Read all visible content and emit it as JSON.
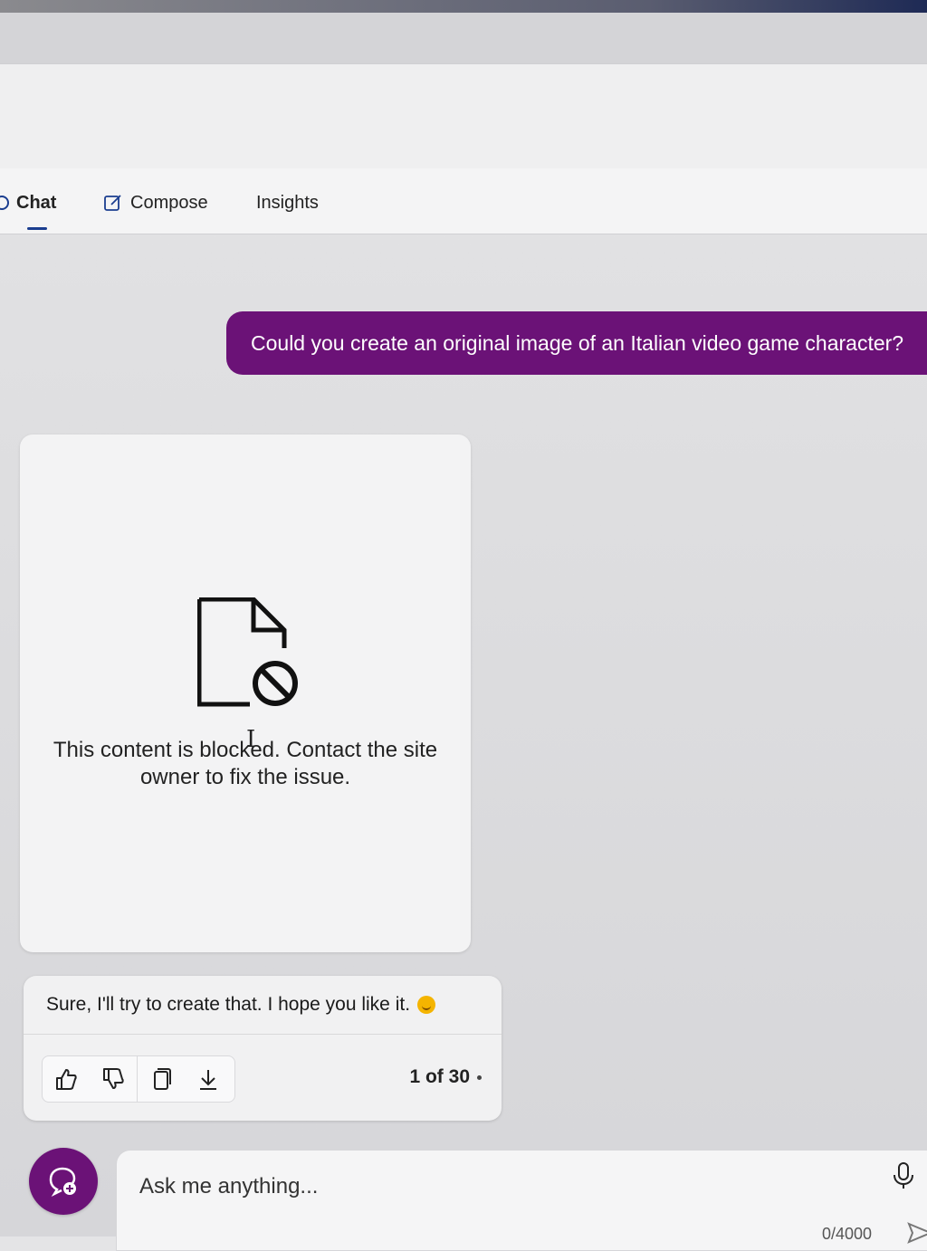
{
  "tabs": [
    {
      "label": "Chat",
      "active": true
    },
    {
      "label": "Compose",
      "active": false
    },
    {
      "label": "Insights",
      "active": false
    }
  ],
  "conversation": {
    "user_message": "Could you create an original image of an Italian video game character?",
    "blocked_card": {
      "icon": "blocked-document-icon",
      "message": "This content is blocked. Contact the site owner to fix the issue."
    },
    "reply": {
      "text": "Sure, I'll try to create that. I hope you like it.",
      "emoji": "smiling-face-emoji",
      "actions": [
        "thumbs-up-icon",
        "thumbs-down-icon",
        "copy-icon",
        "download-icon"
      ],
      "page_counter": "1 of 30"
    }
  },
  "composer": {
    "placeholder": "Ask me anything...",
    "char_count": "0/4000",
    "new_topic_icon": "new-topic-icon",
    "mic_icon": "microphone-icon",
    "send_icon": "send-icon"
  },
  "colors": {
    "accent": "#6b1277",
    "tab_indicator": "#1a3d8f"
  }
}
